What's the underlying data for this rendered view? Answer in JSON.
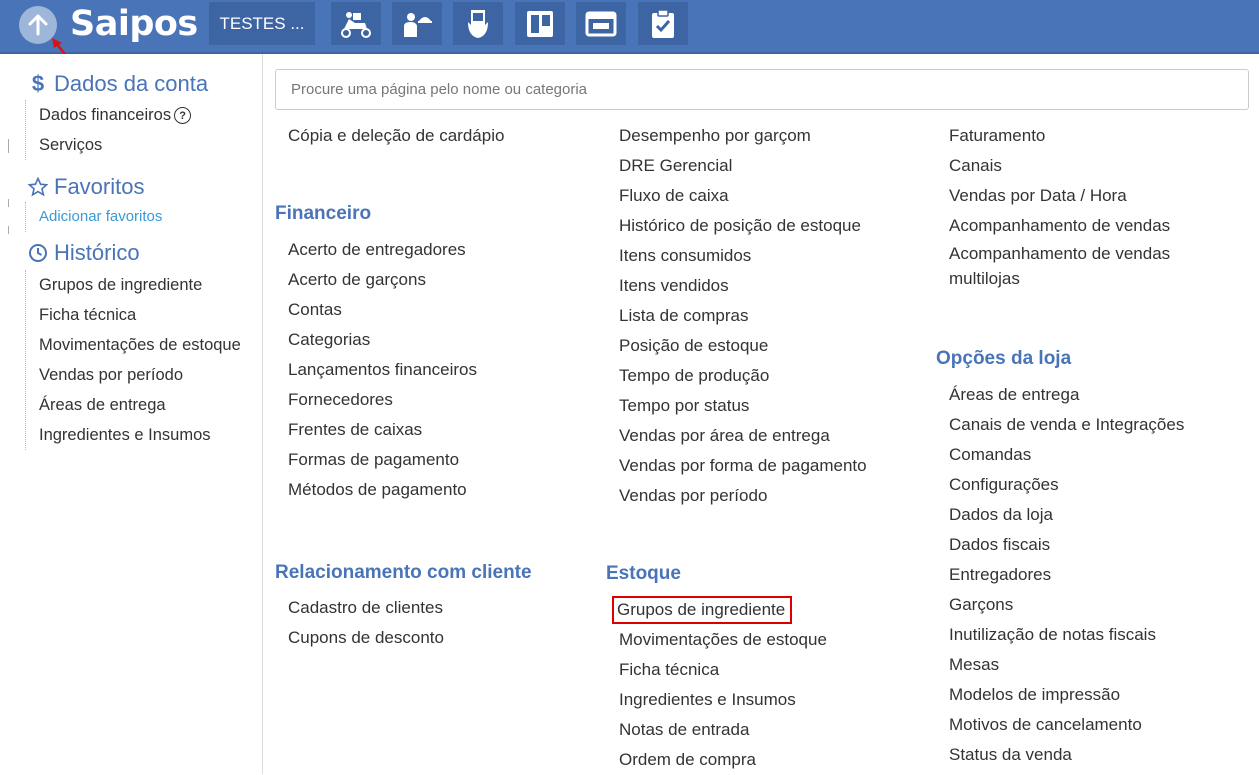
{
  "header": {
    "logo_text": "Saipos",
    "store_button_label": "TESTES ...",
    "icons": [
      "delivery-scooter-icon",
      "waiter-serving-icon",
      "receipt-phone-icon",
      "kanban-board-icon",
      "layout-window-icon",
      "clipboard-check-icon"
    ]
  },
  "sidebar": {
    "account": {
      "title": "Dados da conta",
      "icon": "dollar-icon",
      "items": [
        "Dados financeiros",
        "Serviços"
      ]
    },
    "favorites": {
      "title": "Favoritos",
      "icon": "star-icon",
      "add_link": "Adicionar favoritos"
    },
    "history": {
      "title": "Histórico",
      "icon": "clock-icon",
      "items": [
        "Grupos de ingrediente",
        "Ficha técnica",
        "Movimentações de estoque",
        "Vendas por período",
        "Áreas de entrega",
        "Ingredientes e Insumos"
      ]
    }
  },
  "search": {
    "placeholder": "Procure uma página pelo nome ou categoria"
  },
  "menu": {
    "col1_top": [
      "Cópia e deleção de cardápio"
    ],
    "financeiro": {
      "title": "Financeiro",
      "items": [
        "Acerto de entregadores",
        "Acerto de garçons",
        "Contas",
        "Categorias",
        "Lançamentos financeiros",
        "Fornecedores",
        "Frentes de caixas",
        "Formas de pagamento",
        "Métodos de pagamento"
      ]
    },
    "relacionamento": {
      "title": "Relacionamento com cliente",
      "items": [
        "Cadastro de clientes",
        "Cupons de desconto"
      ]
    },
    "col2_top": [
      "Desempenho por garçom",
      "DRE Gerencial",
      "Fluxo de caixa",
      "Histórico de posição de estoque",
      "Itens consumidos",
      "Itens vendidos",
      "Lista de compras",
      "Posição de estoque",
      "Tempo de produção",
      "Tempo por status",
      "Vendas por área de entrega",
      "Vendas por forma de pagamento",
      "Vendas por período"
    ],
    "estoque": {
      "title": "Estoque",
      "items": [
        "Grupos de ingrediente",
        "Movimentações de estoque",
        "Ficha técnica",
        "Ingredientes e Insumos",
        "Notas de entrada",
        "Ordem de compra"
      ]
    },
    "col3_top": [
      "Faturamento",
      "Canais",
      "Vendas por Data / Hora",
      "Acompanhamento de vendas",
      "Acompanhamento de vendas multilojas"
    ],
    "opcoes": {
      "title": "Opções da loja",
      "items": [
        "Áreas de entrega",
        "Canais de venda e Integrações",
        "Comandas",
        "Configurações",
        "Dados da loja",
        "Dados fiscais",
        "Entregadores",
        "Garçons",
        "Inutilização de notas fiscais",
        "Mesas",
        "Modelos de impressão",
        "Motivos de cancelamento",
        "Status da venda"
      ]
    }
  },
  "colors": {
    "header_bg": "#4a74b8",
    "accent": "#4a74b8",
    "link": "#3a9ad9",
    "highlight": "#dd0000"
  }
}
